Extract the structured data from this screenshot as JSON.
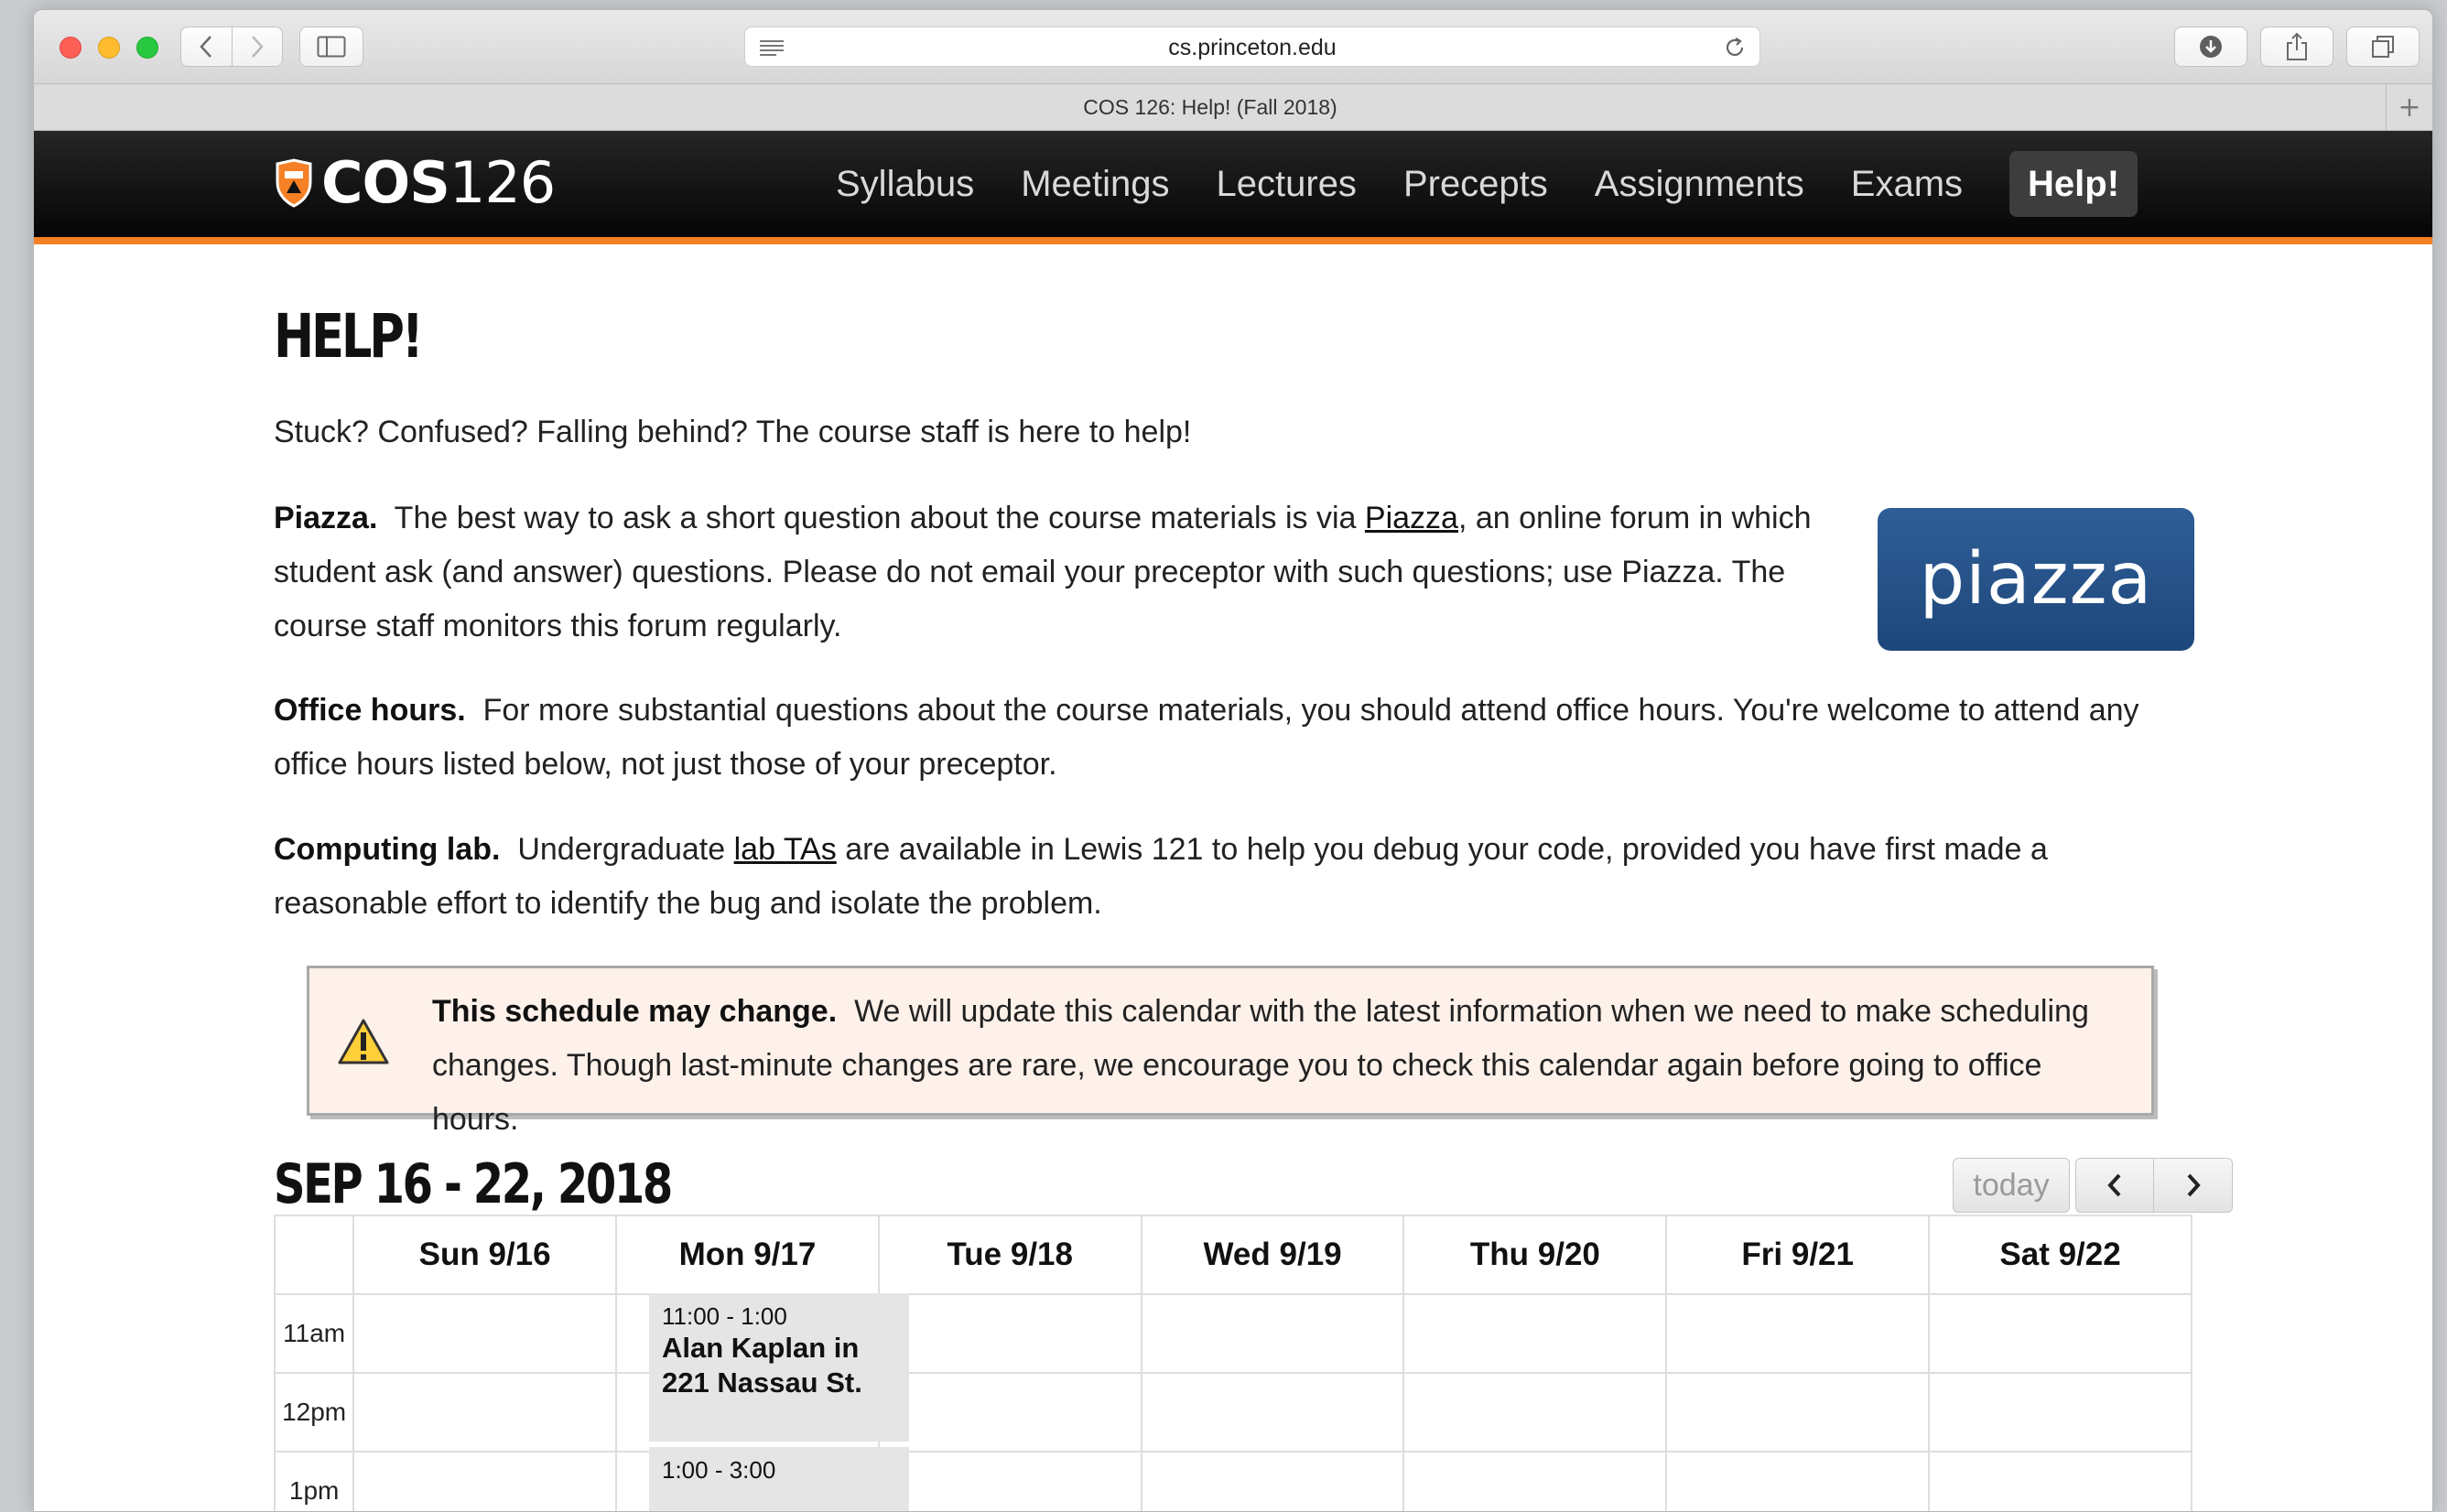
{
  "browser": {
    "url": "cs.princeton.edu",
    "tab_title": "COS 126: Help! (Fall 2018)",
    "icons": [
      "back-icon",
      "forward-icon",
      "sidebar-icon",
      "reader-icon",
      "reload-icon",
      "download-icon",
      "share-icon",
      "tabs-icon",
      "new-tab-icon"
    ]
  },
  "site": {
    "logo_bold": "COS",
    "logo_num": "126",
    "nav": [
      "Syllabus",
      "Meetings",
      "Lectures",
      "Precepts",
      "Assignments",
      "Exams"
    ],
    "nav_active": "Help!",
    "accent": "#f58025"
  },
  "page": {
    "title": "HELP!",
    "intro": "Stuck? Confused? Falling behind? The course staff is here to help!",
    "piazza": {
      "heading": "Piazza.",
      "text_before": "The best way to ask a short question about the course materials is via",
      "link": "Piazza",
      "text_after": ", an online forum in which student ask (and answer) questions. Please do not email your preceptor with such questions; use Piazza. The course staff monitors this forum regularly.",
      "logo_text": "piazza"
    },
    "office_hours": {
      "heading": "Office hours.",
      "text": "For more substantial questions about the course materials, you should attend office hours. You're welcome to attend any office hours listed below, not just those of your preceptor."
    },
    "lab": {
      "heading": "Computing lab.",
      "text_before": "Undergraduate",
      "link": "lab TAs",
      "text_after": "are available in Lewis 121 to help you debug your code, provided you have first made a reasonable effort to identify the bug and isolate the problem."
    },
    "alert": {
      "heading": "This schedule may change.",
      "text": "We will update this calendar with the latest information when we need to make scheduling changes. Though last-minute changes are rare, we encourage you to check this calendar again before going to office hours."
    }
  },
  "calendar": {
    "week_title": "SEP 16 - 22, 2018",
    "today_label": "today",
    "days": [
      "Sun 9/16",
      "Mon 9/17",
      "Tue 9/18",
      "Wed 9/19",
      "Thu 9/20",
      "Fri 9/21",
      "Sat 9/22"
    ],
    "times": [
      "11am",
      "12pm",
      "1pm"
    ],
    "events": [
      {
        "time": "11:00 - 1:00",
        "title": "Alan Kaplan in 221 Nassau St."
      },
      {
        "time": "1:00 - 3:00",
        "title": ""
      }
    ]
  }
}
